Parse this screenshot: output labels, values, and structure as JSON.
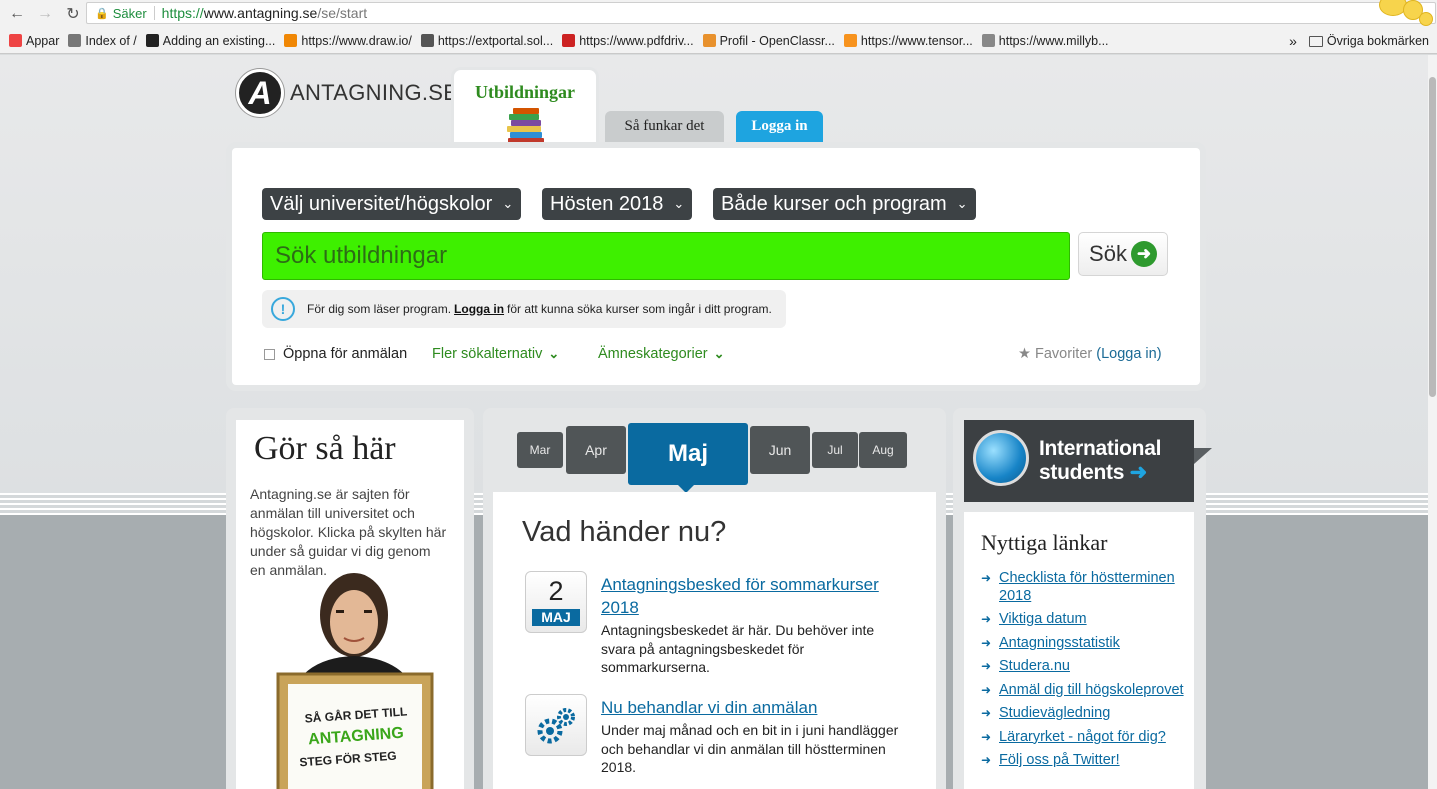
{
  "browser": {
    "secure_label": "Säker",
    "url_scheme": "https://",
    "url_host": "www.antagning.se",
    "url_path": "/se/start",
    "bookmarks": [
      {
        "label": "Appar",
        "icon": "apps-grid-icon",
        "color": "#e44"
      },
      {
        "label": "Index of /",
        "icon": "globe-icon",
        "color": "#777"
      },
      {
        "label": "Adding an existing...",
        "icon": "github-icon",
        "color": "#222"
      },
      {
        "label": "https://www.draw.io/",
        "icon": "drawio-icon",
        "color": "#f08705"
      },
      {
        "label": "https://extportal.sol...",
        "icon": "page-icon",
        "color": "#555"
      },
      {
        "label": "https://www.pdfdriv...",
        "icon": "pd-icon",
        "color": "#c22"
      },
      {
        "label": "Profil - OpenClassr...",
        "icon": "openclassrooms-icon",
        "color": "#e8912d"
      },
      {
        "label": "https://www.tensor...",
        "icon": "tensorflow-icon",
        "color": "#f7931e"
      },
      {
        "label": "https://www.millyb...",
        "icon": "milly-icon",
        "color": "#888"
      }
    ],
    "more_bookmarks": "»",
    "other_bookmarks": "Övriga bokmärken"
  },
  "header": {
    "logo_letter": "A",
    "logo_text": "ANTAGNING.SE",
    "tab_main": "Utbildningar",
    "tab_how": "Så funkar det",
    "tab_login": "Logga in"
  },
  "search": {
    "dropdowns": [
      {
        "label": "Välj universitet/högskolor"
      },
      {
        "label": "Hösten 2018"
      },
      {
        "label": "Både kurser och program"
      }
    ],
    "placeholder": "Sök utbildningar",
    "button": "Sök",
    "info_pre": "För dig som läser program.",
    "info_link": "Logga in",
    "info_post": "för att kunna söka kurser som ingår i ditt program.",
    "open_checkbox": "Öppna för anmälan",
    "more_options": "Fler sökalternativ",
    "subject_categories": "Ämneskategorier",
    "favorites": "Favoriter",
    "favorites_login": "(Logga in)"
  },
  "how_to": {
    "title": "Gör så här",
    "text": "Antagning.se är sajten för anmälan till universitet och högskolor. Klicka på skylten här under så guidar vi dig genom en anmälan.",
    "sign_line1": "SÅ GÅR DET TILL",
    "sign_line2": "ANTAGNING",
    "sign_line3": "STEG FÖR STEG"
  },
  "timeline": {
    "months": [
      "Mar",
      "Apr",
      "Maj",
      "Jun",
      "Jul",
      "Aug"
    ],
    "active": "Maj",
    "heading": "Vad händer nu?",
    "events": [
      {
        "day": "2",
        "month": "MAJ",
        "title": "Antagningsbesked för sommarkurser 2018",
        "desc": "Antagningsbeskedet är här. Du behöver inte svara på antagningsbeskedet för sommarkurserna."
      },
      {
        "title": "Nu behandlar vi din anmälan",
        "desc": "Under maj månad och en bit in i juni handlägger och behandlar vi din anmälan till höstterminen 2018."
      }
    ]
  },
  "international": {
    "line1": "International",
    "line2": "students",
    "arrow": "➜"
  },
  "useful_links": {
    "title": "Nyttiga länkar",
    "items": [
      "Checklista för höstterminen 2018",
      "Viktiga datum",
      "Antagningsstatistik",
      "Studera.nu",
      "Anmäl dig till högskoleprovet",
      "Studievägledning",
      "Läraryrket - något för dig?",
      "Följ oss på Twitter!"
    ]
  }
}
